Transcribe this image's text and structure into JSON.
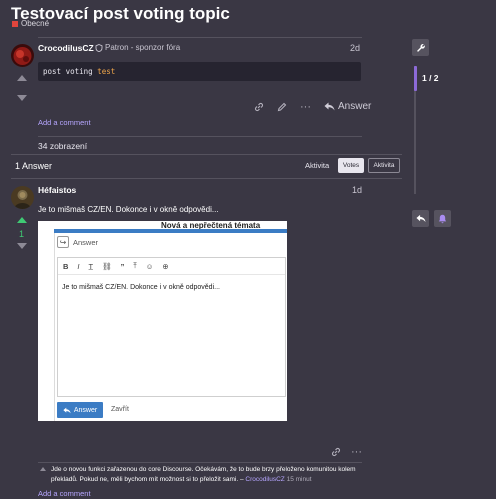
{
  "topic": {
    "title": "Testovací post voting topic",
    "category": "Obecné",
    "category_color": "#e0453d"
  },
  "first_post": {
    "username": "CrocodilusCZ",
    "user_title": "Patron - sponzor fóra",
    "date": "2d",
    "code_plain": "post voting ",
    "code_keyword": "test",
    "answer_label": "Answer",
    "add_comment": "Add a comment"
  },
  "views": "34 zobrazení",
  "answers_header": {
    "count_label": "1 Answer",
    "sort_label": "Aktivita",
    "tabs": [
      "Votes",
      "Aktivita"
    ],
    "active_tab": "Votes"
  },
  "answer_post": {
    "username": "Héfaistos",
    "date": "1d",
    "vote_count": "1",
    "text": "Je to mišmaš CZ/EN. Dokonce i v okně odpovědi...",
    "embedded": {
      "heading": "Nová a nepřečtená témata",
      "reply_label": "Answer",
      "toolbar_icons": [
        "B",
        "I",
        "T̲",
        "⛓",
        "”",
        "⤒",
        "☺",
        "⊕"
      ],
      "editor_text": "Je to mišmaš CZ/EN. Dokonce i v okně odpovědi...",
      "submit_label": "Answer",
      "close_label": "Zavřít"
    },
    "comment": {
      "text": "Jde o novou funkci zařazenou do core Discourse. Očekávám, že to bude brzy přeloženo komunitou kolem překladů. Pokud ne, měli bychom mít možnost si to přeložit sami.",
      "separator": "–",
      "author": "CrocodilusCZ",
      "ago": "15 minut"
    },
    "add_comment": "Add a comment"
  },
  "timeline": {
    "position": "1 / 2"
  },
  "colors": {
    "background": "#3a3744",
    "accent": "#8c6ad8",
    "link": "#b6a6ff",
    "upvote_active": "#3fca74"
  }
}
